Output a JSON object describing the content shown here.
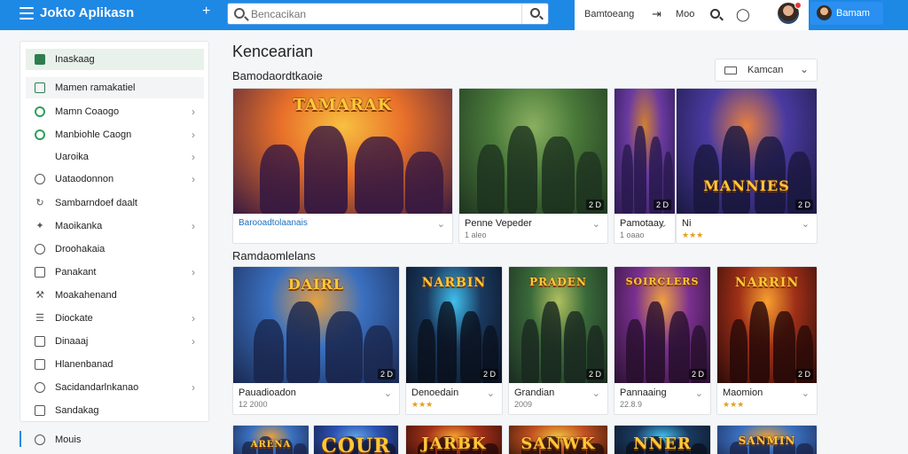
{
  "header": {
    "app_title": "Jokto Aplikasn",
    "plus_icon": "plus-icon",
    "search_placeholder": "Bencacikan",
    "link1": "Bamtoeang",
    "link2": "Moo",
    "user_label": "Bamam"
  },
  "sidebar": {
    "items": [
      {
        "label": "Inaskaag",
        "icon": "apps-icon",
        "active": true,
        "chevron": false
      },
      {
        "label": "Mamen ramakatiel",
        "icon": "chat-icon",
        "sub": true,
        "chevron": false
      },
      {
        "label": "Mamn Coaogo",
        "icon": "whatsapp-icon",
        "chevron": true
      },
      {
        "label": "Manbiohle Caogn",
        "icon": "circle-check-icon",
        "chevron": true
      },
      {
        "label": "Uaroika",
        "icon": "none",
        "chevron": true
      },
      {
        "label": "Uataodonnon",
        "icon": "clock-icon",
        "chevron": true
      },
      {
        "label": "Sambarndoef daalt",
        "icon": "refresh-icon",
        "chevron": false
      },
      {
        "label": "Maoikanka",
        "icon": "pin-icon",
        "chevron": true
      },
      {
        "label": "Droohakaia",
        "icon": "circle-icon",
        "chevron": false
      },
      {
        "label": "Panakant",
        "icon": "box-icon",
        "chevron": true
      },
      {
        "label": "Moakahenand",
        "icon": "tool-icon",
        "chevron": false
      },
      {
        "label": "Diockate",
        "icon": "list-icon",
        "chevron": true
      },
      {
        "label": "Dinaaaj",
        "icon": "calendar-icon",
        "chevron": true
      },
      {
        "label": "Hlanenbanad",
        "icon": "doc-icon",
        "chevron": false
      },
      {
        "label": "Sacidandarlnkanao",
        "icon": "eye-icon",
        "chevron": true
      },
      {
        "label": "Sandakag",
        "icon": "table-icon",
        "chevron": false
      }
    ],
    "bottom_item": {
      "label": "Mouis",
      "icon": "settings-icon"
    }
  },
  "main": {
    "title": "Kencearian",
    "section1_title": "Bamodaordtkaoie",
    "section2_title": "Ramdaomlelans",
    "sort": {
      "label": "Kamcan",
      "icon": "sort-icon"
    },
    "row1": [
      {
        "logo": "TAMARAK",
        "name": "Barooadtolaanais",
        "meta": "",
        "badge": "",
        "palette": "orange"
      },
      {
        "logo": "",
        "name": "Penne Vepeder",
        "meta": "1 aleo",
        "badge": "2 D",
        "palette": "green"
      },
      {
        "logo": "",
        "name": "Pamotaay",
        "meta": "1 oaao",
        "badge": "2 D",
        "palette": "purple"
      },
      {
        "logo": "MANNIES",
        "name": "Ni",
        "meta": "",
        "badge": "2 D",
        "palette": "purple2",
        "stars": "★★★"
      }
    ],
    "row2": [
      {
        "logo": "DAIRL",
        "name": "Pauadioadon",
        "meta": "12 2000",
        "badge": "2 D",
        "palette": "blue"
      },
      {
        "logo": "NARBIN",
        "name": "Denoedain",
        "meta": "",
        "badge": "2 D",
        "palette": "dark",
        "stars": "★★★"
      },
      {
        "logo": "PRADEN",
        "name": "Grandian",
        "meta": "2009",
        "badge": "2 D",
        "palette": "green2"
      },
      {
        "logo": "SOIRCLERS",
        "name": "Pannaaing",
        "meta": "22.8.9",
        "badge": "2 D",
        "palette": "purple3"
      },
      {
        "logo": "NARRIN",
        "name": "Maomion",
        "meta": "",
        "badge": "2 D",
        "palette": "fire",
        "stars": "★★★"
      }
    ],
    "row3": [
      {
        "logo": "ARENA",
        "palette": "blue"
      },
      {
        "logo": "COUR",
        "palette": "blue2"
      },
      {
        "logo": "JARBK",
        "palette": "fire"
      },
      {
        "logo": "SANWK",
        "palette": "fire2"
      },
      {
        "logo": "NNER",
        "palette": "dark"
      },
      {
        "logo": "SANMIN",
        "palette": "blue"
      }
    ]
  }
}
